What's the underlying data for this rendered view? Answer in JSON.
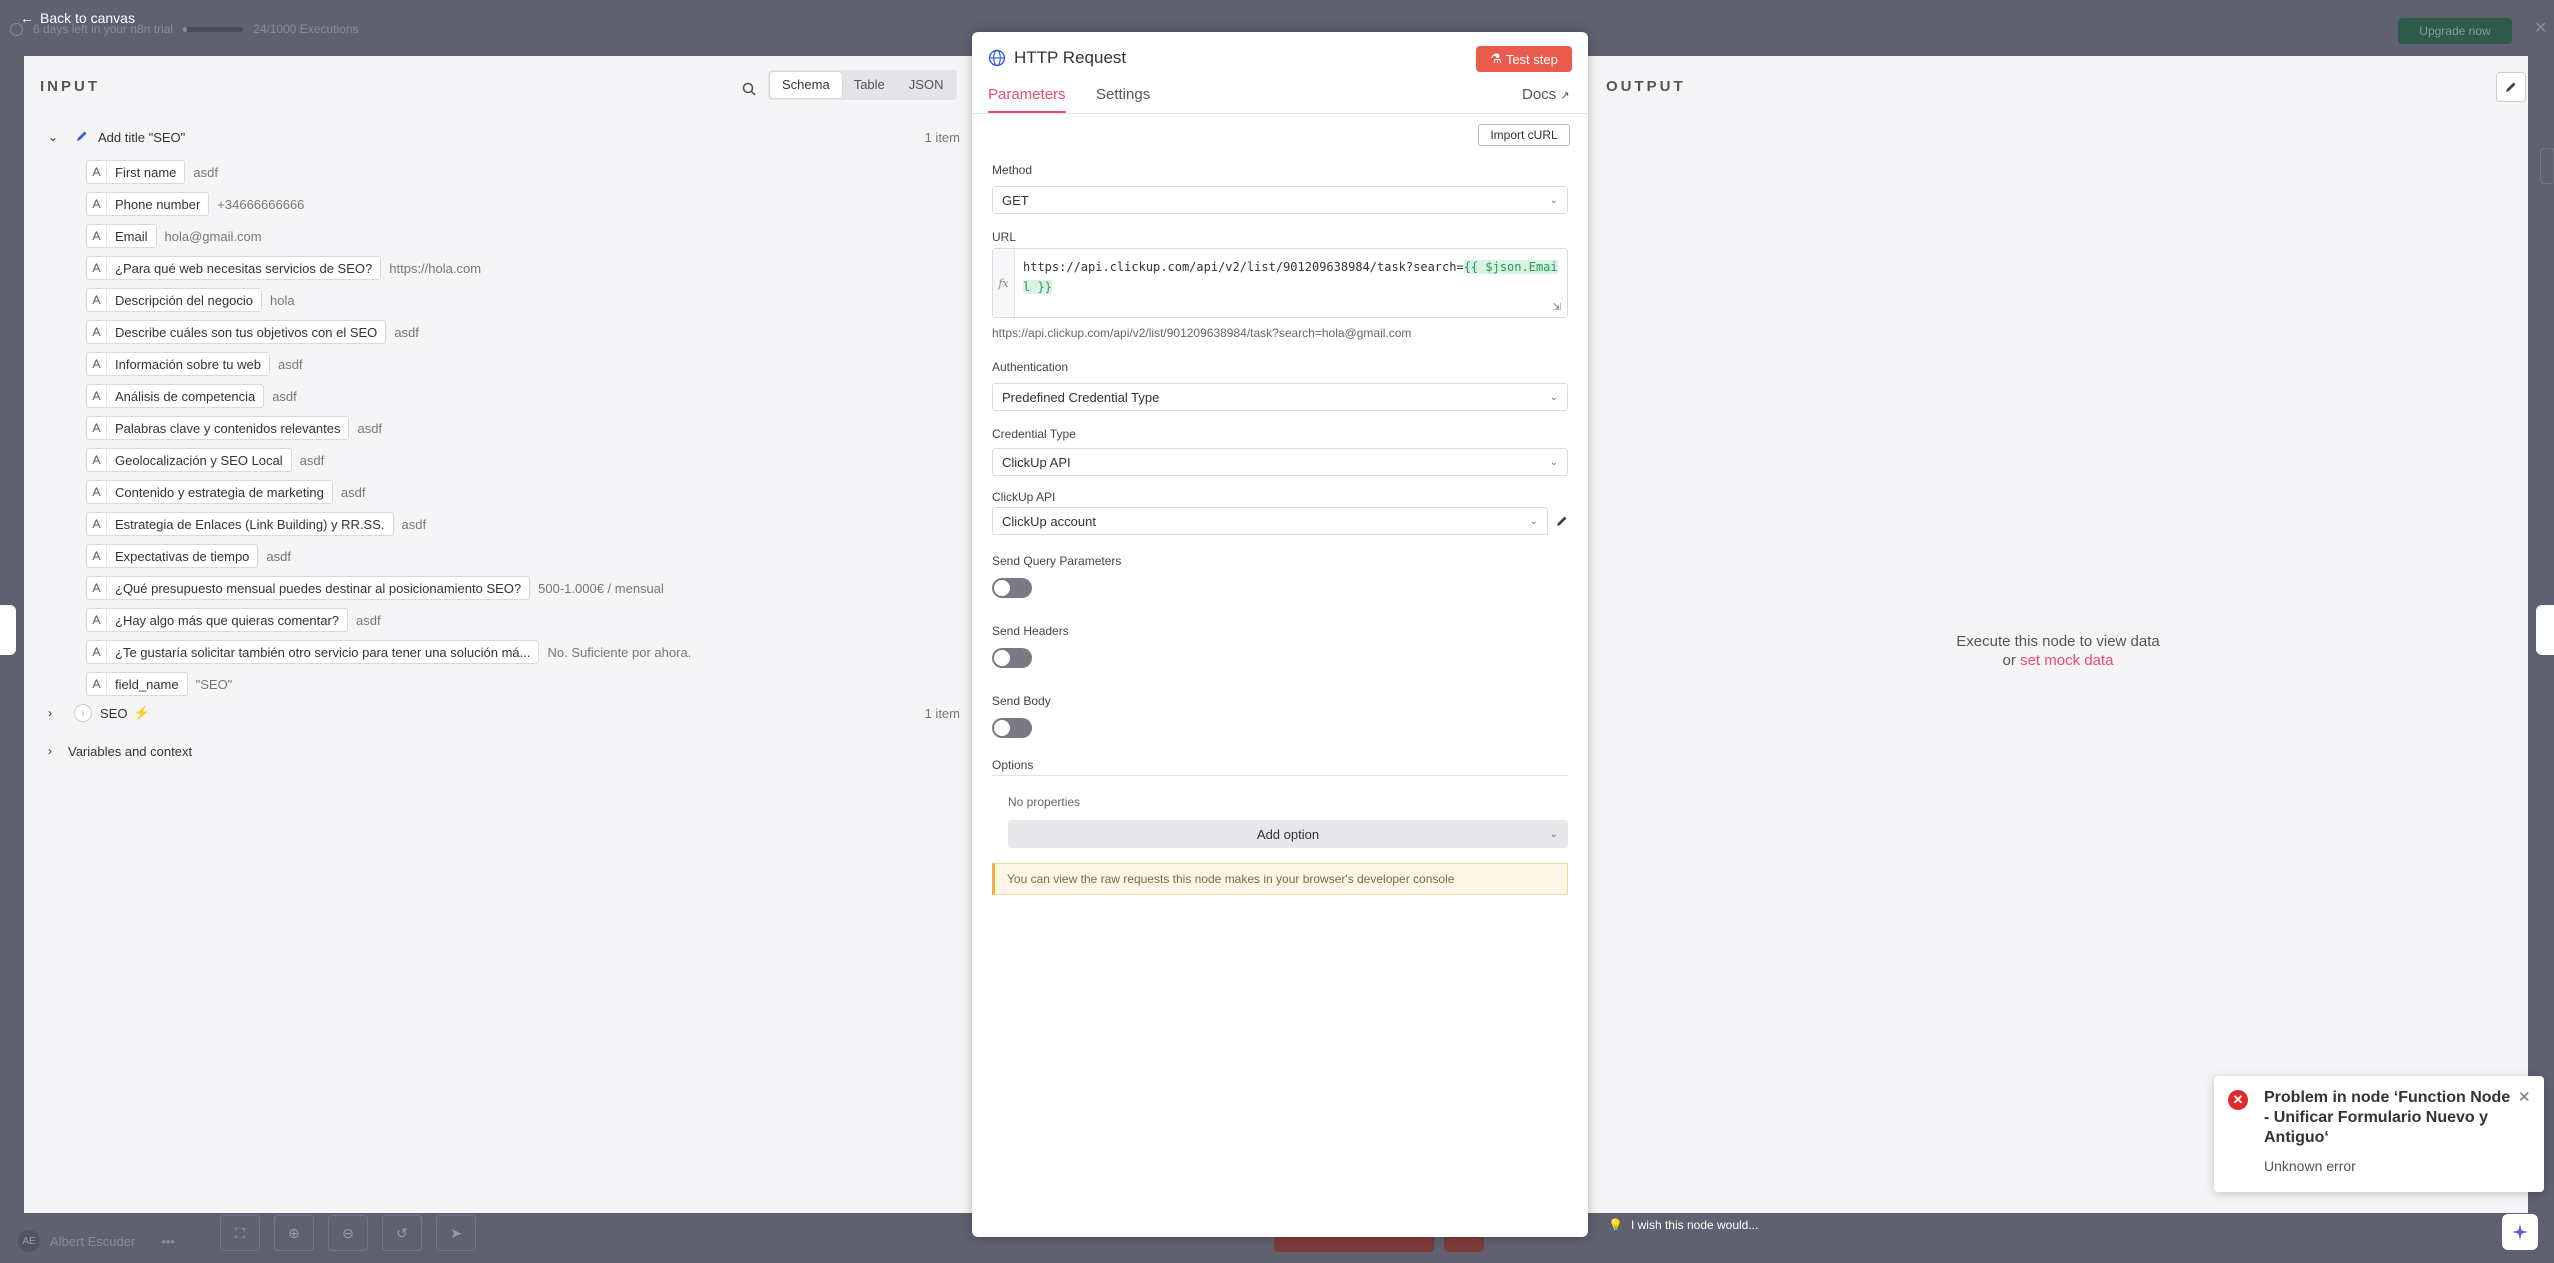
{
  "canvas": {
    "back_label": "Back to canvas",
    "trial_text": "6 days left in your n8n trial",
    "executions_text": "24/1000 Executions",
    "upgrade_label": "Upgrade now",
    "user_initials": "AE",
    "user_name": "Albert Escuder",
    "user_menu": "•••"
  },
  "input": {
    "title": "INPUT",
    "view_tabs": [
      "Schema",
      "Table",
      "JSON"
    ],
    "active_view": "Schema",
    "node_name": "Add title \"SEO\"",
    "item_count": "1 item",
    "fields": [
      {
        "type": "A",
        "name": "First name",
        "value": "asdf"
      },
      {
        "type": "A",
        "name": "Phone number",
        "value": "+34666666666"
      },
      {
        "type": "A",
        "name": "Email",
        "value": "hola@gmail.com"
      },
      {
        "type": "A",
        "name": "¿Para qué web necesitas servicios de SEO?",
        "value": "https://hola.com"
      },
      {
        "type": "A",
        "name": "Descripción del negocio",
        "value": "hola"
      },
      {
        "type": "A",
        "name": "Describe cuáles son tus objetivos con el SEO",
        "value": "asdf"
      },
      {
        "type": "A",
        "name": "Información sobre tu web",
        "value": "asdf"
      },
      {
        "type": "A",
        "name": "Análisis de competencia",
        "value": "asdf"
      },
      {
        "type": "A",
        "name": "Palabras clave y contenidos relevantes",
        "value": "asdf"
      },
      {
        "type": "A",
        "name": "Geolocalización y SEO Local",
        "value": "asdf"
      },
      {
        "type": "A",
        "name": "Contenido y estrategia de marketing",
        "value": "asdf"
      },
      {
        "type": "A",
        "name": "Estrategia de Enlaces (Link Building) y RR.SS.",
        "value": "asdf"
      },
      {
        "type": "A",
        "name": "Expectativas de tiempo",
        "value": "asdf"
      },
      {
        "type": "A",
        "name": "¿Qué presupuesto mensual puedes destinar al posicionamiento SEO?",
        "value": "500-1.000€ / mensual"
      },
      {
        "type": "A",
        "name": "¿Hay algo más que quieras comentar?",
        "value": "asdf"
      },
      {
        "type": "A",
        "name": "¿Te gustaría solicitar también otro servicio para tener una solución má...",
        "value": "No. Suficiente por ahora."
      },
      {
        "type": "A",
        "name": "field_name",
        "value": "\"SEO\""
      }
    ],
    "seo_node": {
      "name": "SEO",
      "badge": "i",
      "count": "1 item"
    },
    "variables_label": "Variables and context"
  },
  "node": {
    "title": "HTTP Request",
    "test_label": "Test step",
    "tabs": [
      "Parameters",
      "Settings"
    ],
    "active_tab": "Parameters",
    "docs_label": "Docs",
    "import_label": "Import cURL",
    "method": {
      "label": "Method",
      "value": "GET"
    },
    "url": {
      "label": "URL",
      "prefix": "https://api.clickup.com/api/v2/list/901209638984/task?search=",
      "expression": "{{ $json.Email }}",
      "preview": "https://api.clickup.com/api/v2/list/901209638984/task?search=hola@gmail.com"
    },
    "authentication": {
      "label": "Authentication",
      "value": "Predefined Credential Type"
    },
    "credential_type": {
      "label": "Credential Type",
      "value": "ClickUp API"
    },
    "clickup_api": {
      "label": "ClickUp API",
      "value": "ClickUp account"
    },
    "send_query": {
      "label": "Send Query Parameters",
      "on": false
    },
    "send_headers": {
      "label": "Send Headers",
      "on": false
    },
    "send_body": {
      "label": "Send Body",
      "on": false
    },
    "options_label": "Options",
    "no_properties": "No properties",
    "add_option": "Add option",
    "notice": "You can view the raw requests this node makes in your browser's developer console"
  },
  "output": {
    "title": "OUTPUT",
    "message": "Execute this node to view data",
    "or_text": "or",
    "mock_link": "set mock data"
  },
  "wish_label": "I wish this node would...",
  "toast": {
    "title": "Problem in node ‘Function Node - Unificar Formulario Nuevo y Antiguo‘",
    "message": "Unknown error"
  },
  "colors": {
    "accent": "#ea4b71",
    "test_button": "#ea5b4d",
    "error": "#e02b2b"
  }
}
